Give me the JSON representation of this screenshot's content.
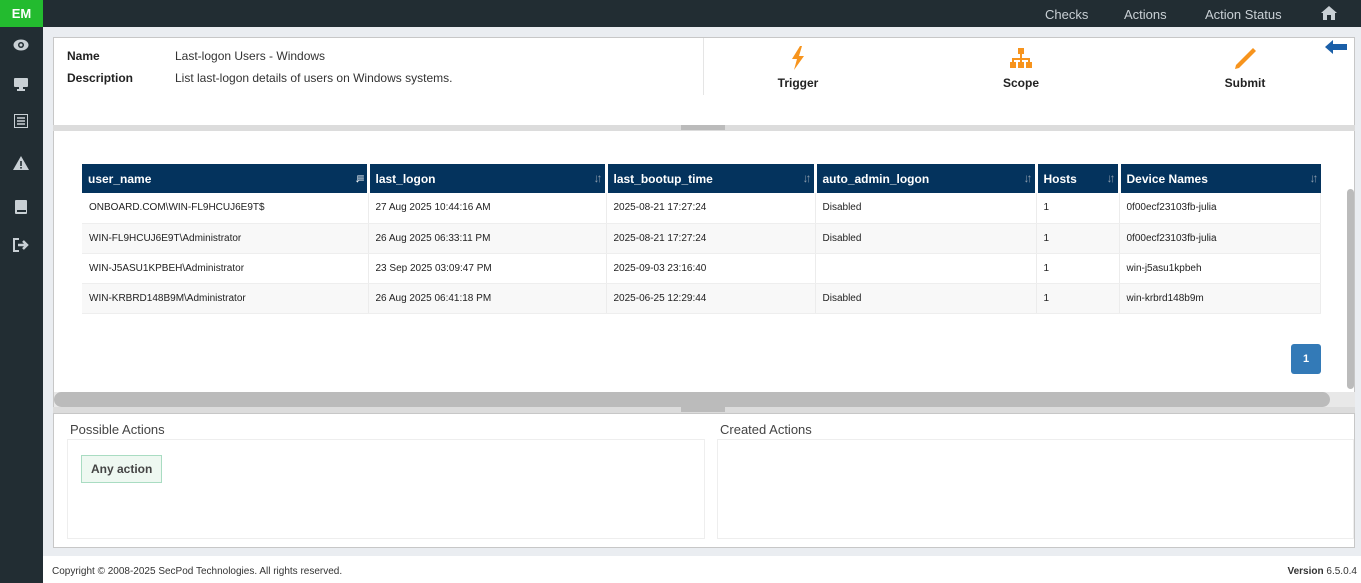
{
  "app": {
    "logo": "EM"
  },
  "nav": {
    "checks": "Checks",
    "actions": "Actions",
    "action_status": "Action Status"
  },
  "sidebar": [
    "eye-icon",
    "monitor-icon",
    "list-icon",
    "warning-icon",
    "book-icon",
    "sign-out-icon"
  ],
  "details": {
    "name_label": "Name",
    "name": "Last-logon Users - Windows",
    "description_label": "Description",
    "description": "List last-logon details of users on Windows systems."
  },
  "toolbar": {
    "trigger": "Trigger",
    "scope": "Scope",
    "submit": "Submit"
  },
  "colors": {
    "accent": "#f7941d",
    "header": "#04335d",
    "brand": "#23bb2f"
  },
  "table": {
    "columns": [
      "user_name",
      "last_logon",
      "last_bootup_time",
      "auto_admin_logon",
      "Hosts",
      "Device Names"
    ],
    "rows": [
      [
        "ONBOARD.COM\\WIN-FL9HCUJ6E9T$",
        "27 Aug 2025 10:44:16 AM",
        "2025-08-21 17:27:24",
        "Disabled",
        "1",
        "0f00ecf23103fb-julia"
      ],
      [
        "WIN-FL9HCUJ6E9T\\Administrator",
        "26 Aug 2025 06:33:11 PM",
        "2025-08-21 17:27:24",
        "Disabled",
        "1",
        "0f00ecf23103fb-julia"
      ],
      [
        "WIN-J5ASU1KPBEH\\Administrator",
        "23 Sep 2025 03:09:47 PM",
        "2025-09-03 23:16:40",
        "",
        "1",
        "win-j5asu1kpbeh"
      ],
      [
        "WIN-KRBRD148B9M\\Administrator",
        "26 Aug 2025 06:41:18 PM",
        "2025-06-25 12:29:44",
        "Disabled",
        "1",
        "win-krbrd148b9m"
      ]
    ]
  },
  "pagination": {
    "current": "1"
  },
  "actions": {
    "possible_title": "Possible Actions",
    "created_title": "Created Actions",
    "any_action": "Any action"
  },
  "footer": {
    "copyright": "Copyright © 2008-2025 SecPod Technologies. All rights reserved.",
    "version_label": "Version",
    "version": "6.5.0.4"
  }
}
